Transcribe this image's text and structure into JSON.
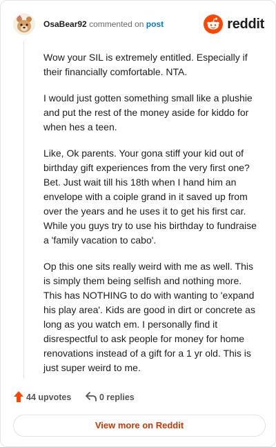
{
  "comment": {
    "author": "OsaBear92",
    "action_text": "commented on",
    "target_link": "post",
    "paragraphs": [
      "Wow your SIL is extremely entitled. Especially if their financially comfortable. NTA.",
      "I would just gotten something small like a plushie and put the rest of the money aside for kiddo for when hes a teen.",
      "Like, Ok parents. Your gona stiff your kid out of birthday gift experiences from the very first one? Bet. Just wait till his 18th when I hand him an envelope with a coiple grand in it saved up from over the years and he uses it to get his first car. While you guys try to use his birthday to fundraise a 'family vacation to cabo'.",
      "Op this one sits really weird with me as well. This is simply them being selfish and nothing more. This has NOTHING to do with wanting to 'expand his play area'. Kids are good in dirt or concrete as long as you watch em. I personally find it disrespectful to ask people for money for home renovations instead of a gift for a 1 yr old. This is just super weird to me."
    ],
    "upvotes_label": "44 upvotes",
    "replies_label": "0 replies"
  },
  "brand": {
    "wordmark": "reddit",
    "icon": "reddit-alien-icon",
    "color": "#ff4500"
  },
  "footer": {
    "view_more_label": "View more on Reddit"
  },
  "icons": {
    "upvote": "upvote-arrow-icon",
    "reply": "reply-arrow-icon"
  },
  "colors": {
    "link": "#0079d3",
    "upvote": "#ff4500",
    "cta": "#cc3700"
  }
}
